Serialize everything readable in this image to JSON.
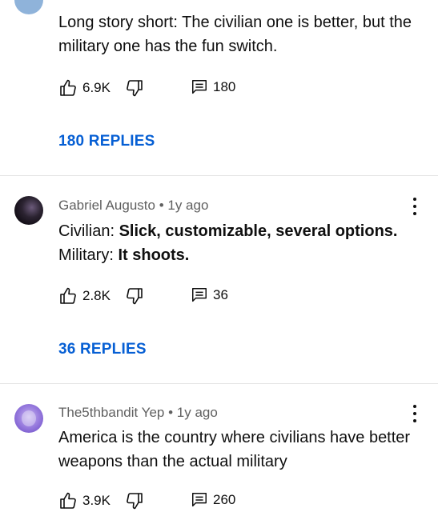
{
  "comments": [
    {
      "author": "",
      "time": "",
      "body_plain": "Long story short: The civilian one is better, but the military one has the fun switch.",
      "likes": "6.9K",
      "replies_count": "180",
      "replies_link": "180 REPLIES"
    },
    {
      "author": "Gabriel Augusto",
      "time": "1y ago",
      "line1_label": "Civilian: ",
      "line1_bold": "Slick, customizable, several options.",
      "line2_label": "Military: ",
      "line2_bold": "It shoots.",
      "likes": "2.8K",
      "replies_count": "36",
      "replies_link": "36 REPLIES"
    },
    {
      "author": "The5thbandit Yep",
      "time": "1y ago",
      "body_plain": "America is the country where civilians have better weapons than the actual military",
      "likes": "3.9K",
      "replies_count": "260"
    }
  ],
  "meta_separator": " • ",
  "colors": {
    "link": "#065fd4",
    "meta": "#606060",
    "text": "#0f0f0f",
    "divider": "#e5e5e5"
  },
  "icons": [
    "thumb-up-icon",
    "thumb-down-icon",
    "reply-comment-icon",
    "more-vert-icon"
  ]
}
